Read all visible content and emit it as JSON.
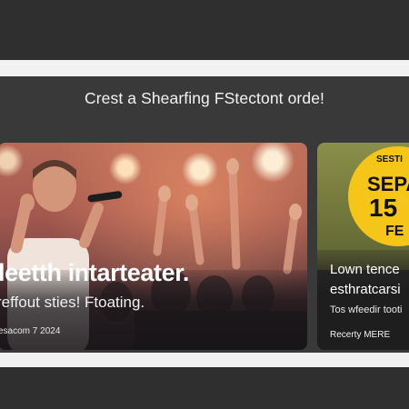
{
  "header": {
    "headline": "Crest a Shearfing FStectont orde!"
  },
  "cards": [
    {
      "title": "leetth intarteater.",
      "subtitle": "reffout sties! Ftoating.",
      "date": "esacom 7 2024"
    },
    {
      "badge_top": "SESTI",
      "badge_line1": "SEPA",
      "badge_line2": "15",
      "badge_line3": "FE",
      "title_line1": "Lown tence",
      "title_line2": "esthratcarsi",
      "subtitle": "Tos wfeedir tooti",
      "link": "Recerty MERE"
    }
  ],
  "colors": {
    "background": "#2d2d2e",
    "strip": "#f1f1f1",
    "band": "#393939",
    "badge": "#f5c518"
  }
}
